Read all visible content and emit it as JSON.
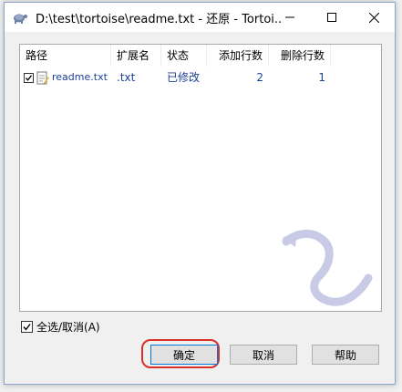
{
  "window": {
    "title": "D:\\test\\tortoise\\readme.txt - 还原 - Tortoi..."
  },
  "list": {
    "columns": [
      "路径",
      "扩展名",
      "状态",
      "添加行数",
      "删除行数"
    ],
    "rows": [
      {
        "checked": true,
        "path": "readme.txt",
        "ext": ".txt",
        "status": "已修改",
        "added": "2",
        "deleted": "1"
      }
    ]
  },
  "select_all": {
    "label": "全选/取消(A)",
    "checked": true
  },
  "buttons": {
    "ok": "确定",
    "cancel": "取消",
    "help": "帮助"
  },
  "colors": {
    "row_text": "#1c3f95",
    "highlight": "#d9302a",
    "watermark": "#c9cbe6"
  },
  "icons": {
    "app": "tortoise-icon",
    "file": "modified-file-icon",
    "minimize": "minimize-icon",
    "maximize": "maximize-icon",
    "close": "close-icon"
  }
}
